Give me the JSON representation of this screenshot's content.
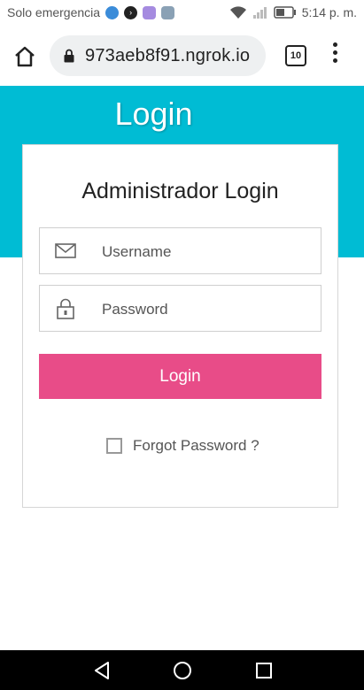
{
  "statusbar": {
    "carrier": "Solo emergencia",
    "time": "5:14 p. m."
  },
  "browser": {
    "url": "973aeb8f91.ngrok.io",
    "tab_count": "10"
  },
  "page": {
    "hero_title": "Login",
    "card_title": "Administrador Login",
    "username_placeholder": "Username",
    "password_placeholder": "Password",
    "login_button": "Login",
    "forgot_label": "Forgot Password ?"
  },
  "colors": {
    "hero": "#00bcd4",
    "button": "#e84c88"
  },
  "icons": {
    "username": "envelope-icon",
    "password": "padlock-icon"
  }
}
